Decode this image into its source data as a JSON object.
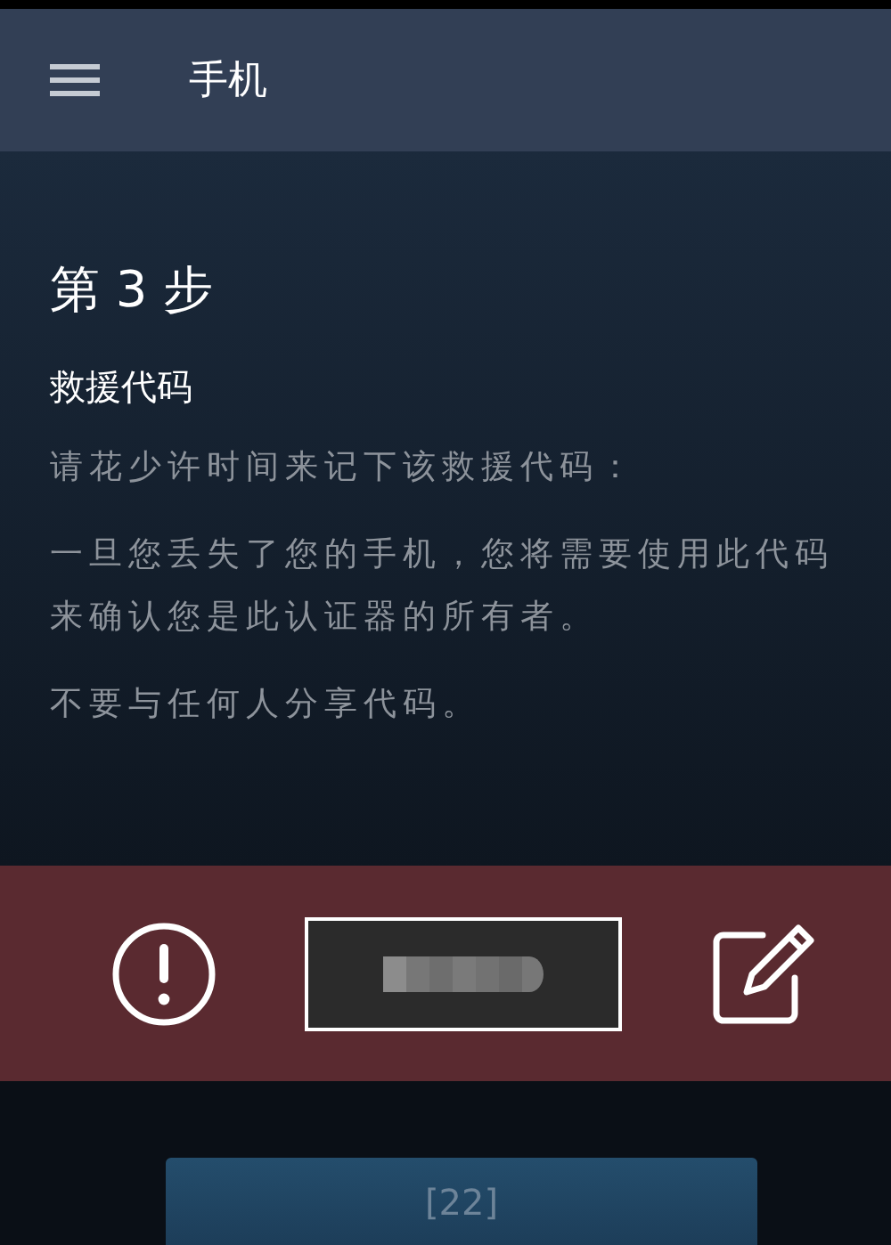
{
  "header": {
    "title": "手机"
  },
  "step_title": "第 3 步",
  "section_title": "救援代码",
  "paragraphs": [
    "请花少许时间来记下该救援代码：",
    "一旦您丢失了您的手机，您将需要使用此代码来确认您是此认证器的所有者。",
    "不要与任何人分享代码。"
  ],
  "code_panel": {
    "code_hidden": true
  },
  "button": {
    "label": "[22]",
    "disabled": true
  }
}
